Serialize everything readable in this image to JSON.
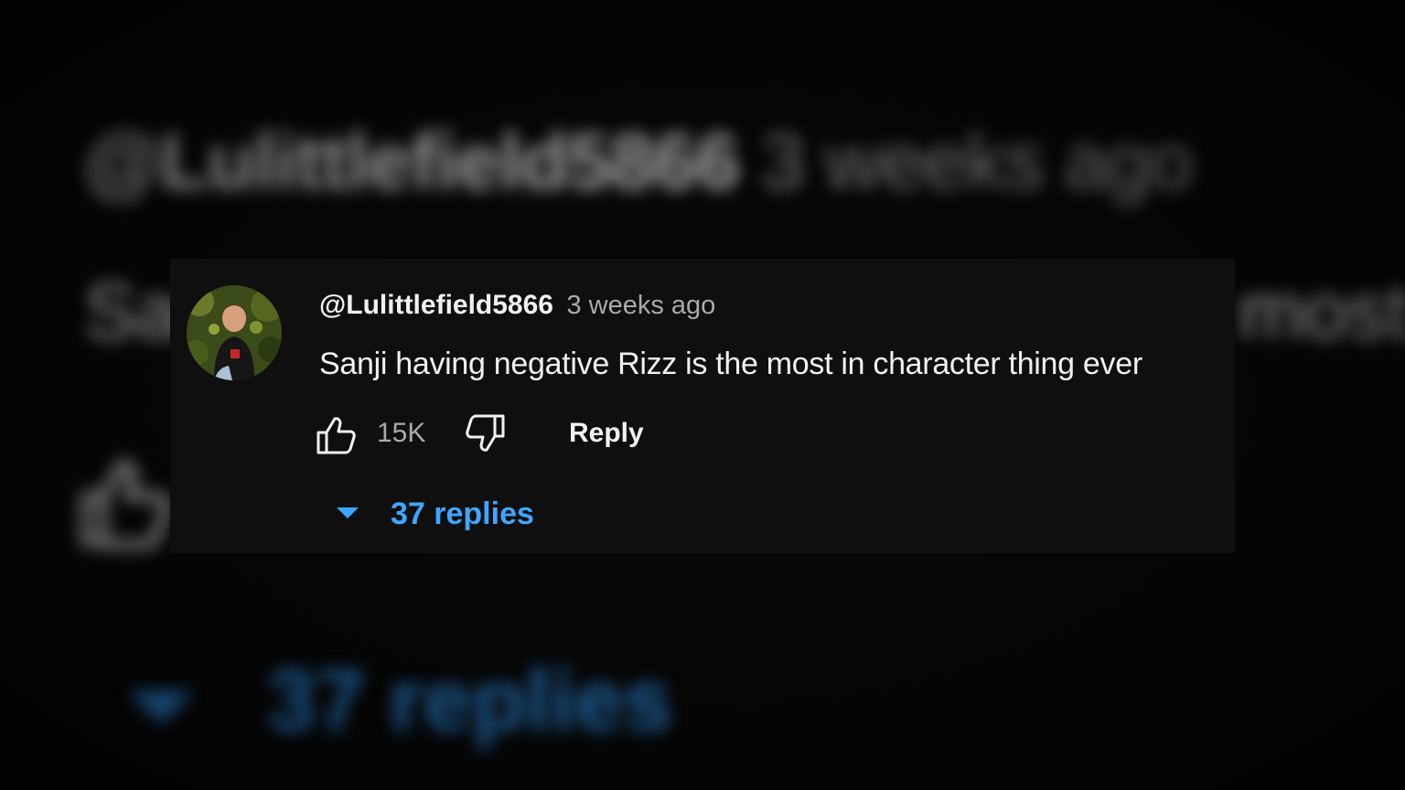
{
  "comment": {
    "author_handle": "@Lulittlefield5866",
    "timestamp": "3 weeks ago",
    "text": "Sanji having negative Rizz is the most in character thing ever",
    "like_count": "15K",
    "reply_label": "Reply",
    "replies_label": "37 replies"
  },
  "icons": {
    "like": "thumbs-up-icon",
    "dislike": "thumbs-down-icon",
    "expand": "caret-down-icon"
  },
  "colors": {
    "background": "#0f0f0f",
    "text_primary": "#f1f1f1",
    "text_secondary": "#aaaaaa",
    "link_blue": "#3ea6ff"
  }
}
